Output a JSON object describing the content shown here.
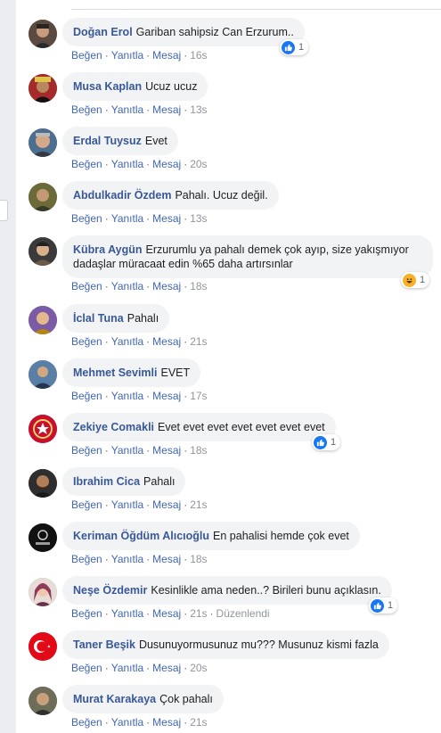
{
  "actions": {
    "like": "Beğen",
    "reply": "Yanıtla",
    "message": "Mesaj",
    "sep": "·",
    "edited": "Düzenlendi"
  },
  "colors": {
    "author": "#385898",
    "link": "#4267b2",
    "bubble": "#f2f3f5",
    "like_badge": "#1877f2",
    "haha_badge": "#f7b125"
  },
  "comments": [
    {
      "author": "Doğan Erol",
      "text": "Gariban sahipsiz Can Erzurum..",
      "time": "16s",
      "reaction": {
        "icon": "like-icon",
        "count": "1"
      }
    },
    {
      "author": "Musa Kaplan",
      "text": "Ucuz ucuz",
      "time": "13s"
    },
    {
      "author": "Erdal Tuysuz",
      "text": "Evet",
      "time": "20s"
    },
    {
      "author": "Abdulkadir Özdem",
      "text": "Pahalı. Ucuz değil.",
      "time": "13s"
    },
    {
      "author": "Kübra Aygün",
      "text": "Erzurumlu ya pahalı demek çok ayıp, size yakışmıyor dadaşlar müracaat edin %65 daha artırsınlar",
      "time": "18s",
      "reaction": {
        "icon": "haha-icon",
        "count": "1"
      }
    },
    {
      "author": "İclal Tuna",
      "text": "Pahalı",
      "time": "21s"
    },
    {
      "author": "Mehmet Sevimli",
      "text": "EVET",
      "time": "17s"
    },
    {
      "author": "Zekiye Comakli",
      "text": "Evet evet evet evet evet evet evet",
      "time": "18s",
      "reaction": {
        "icon": "like-icon",
        "count": "1"
      }
    },
    {
      "author": "Ibrahim Cica",
      "text": "Pahalı",
      "time": "21s"
    },
    {
      "author": "Keriman Öğdüm Alıcıoğlu",
      "text": "En pahalisi hemde çok evet",
      "time": "18s"
    },
    {
      "author": "Neşe Özdemir",
      "text": "Kesinlikle ama neden..? Birileri bunu açıklasın.",
      "time": "21s",
      "edited": true,
      "reaction": {
        "icon": "like-icon",
        "count": "1"
      }
    },
    {
      "author": "Taner Beşik",
      "text": "Dusunuyormusunuz mu??? Musunuz kismi fazla",
      "time": "20s"
    },
    {
      "author": "Murat Karakaya",
      "text": "Çok pahalı",
      "time": "21s"
    }
  ]
}
